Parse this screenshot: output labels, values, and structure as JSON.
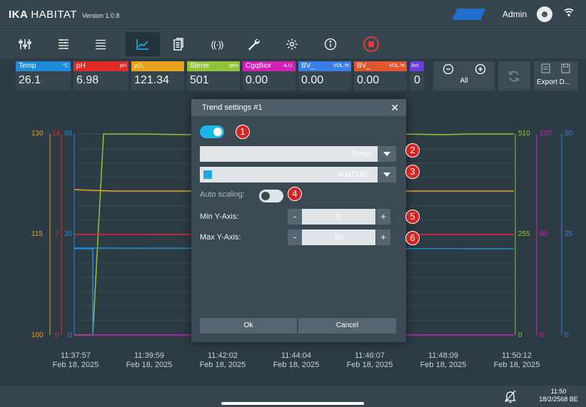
{
  "app": {
    "brand_bold": "IKA",
    "brand_name": "HABITAT",
    "version": "Version 1.0.8",
    "user": "Admin"
  },
  "nav": {
    "icons": [
      "dashboard-icon",
      "settings-sliders-icon",
      "list-icon",
      "trend-chart-icon",
      "report-icon",
      "sensor-icon",
      "wrench-icon",
      "gear-icon",
      "info-icon",
      "stop-icon"
    ],
    "active": "trend-chart-icon"
  },
  "tiles": [
    {
      "label": "Temp",
      "unit": "°C",
      "value": "26.1",
      "color": "#1f8bd8"
    },
    {
      "label": "pH",
      "unit": "pH",
      "value": "6.98",
      "color": "#e12a2a"
    },
    {
      "label": "pO₂",
      "unit": "",
      "value": "121.34",
      "color": "#e8a21d"
    },
    {
      "label": "Stirrer",
      "unit": "rpm",
      "value": "501",
      "color": "#93c23b"
    },
    {
      "label": "CgqBior",
      "unit": "A.U.",
      "value": "0.00",
      "color": "#d21fb4"
    },
    {
      "label": "BV_",
      "unit": "VOL.%",
      "value": "0.00",
      "color": "#3a7ee8"
    },
    {
      "label": "BV_",
      "unit": "VOL.%",
      "value": "0.00",
      "color": "#e0562e"
    },
    {
      "label": "Ant",
      "unit": "",
      "value": "0",
      "color": "#6a3be0"
    }
  ],
  "zoom": {
    "all_label": "All"
  },
  "export": {
    "label": "Export D..."
  },
  "chart": {
    "left_axis_temp": [
      "130",
      "115",
      "100"
    ],
    "left_axis_ph": [
      "14",
      "7",
      "0"
    ],
    "left_axis_po2": [
      "60",
      "30",
      "0"
    ],
    "right_axis_stirrer": [
      "510",
      "255",
      "0"
    ],
    "right_axis_ph2": [
      "120",
      "60",
      "0"
    ],
    "right_axis_other": [
      "50",
      "25",
      "0"
    ],
    "times": [
      {
        "t": "11:37:57",
        "d": "Feb 18, 2025"
      },
      {
        "t": "11:39:59",
        "d": "Feb 18, 2025"
      },
      {
        "t": "11:42:02",
        "d": "Feb 18, 2025"
      },
      {
        "t": "11:44:04",
        "d": "Feb 18, 2025"
      },
      {
        "t": "11:46:07",
        "d": "Feb 18, 2025"
      },
      {
        "t": "11:48:09",
        "d": "Feb 18, 2025"
      },
      {
        "t": "11:50:12",
        "d": "Feb 18, 2025"
      }
    ]
  },
  "modal": {
    "title": "Trend settings #1",
    "enabled": true,
    "channel": "Temp",
    "color_value": "#0071BC",
    "auto_scaling_label": "Auto scaling:",
    "auto_scaling": false,
    "min_label": "Min Y-Axis:",
    "min_value": "0",
    "max_label": "Max Y-Axis:",
    "max_value": "60",
    "ok_label": "Ok",
    "cancel_label": "Cancel",
    "minus": "-",
    "plus": "+",
    "markers": [
      "1",
      "2",
      "3",
      "4",
      "5",
      "6"
    ]
  },
  "status": {
    "time": "11:50",
    "date": "18/2/2568 BE"
  }
}
